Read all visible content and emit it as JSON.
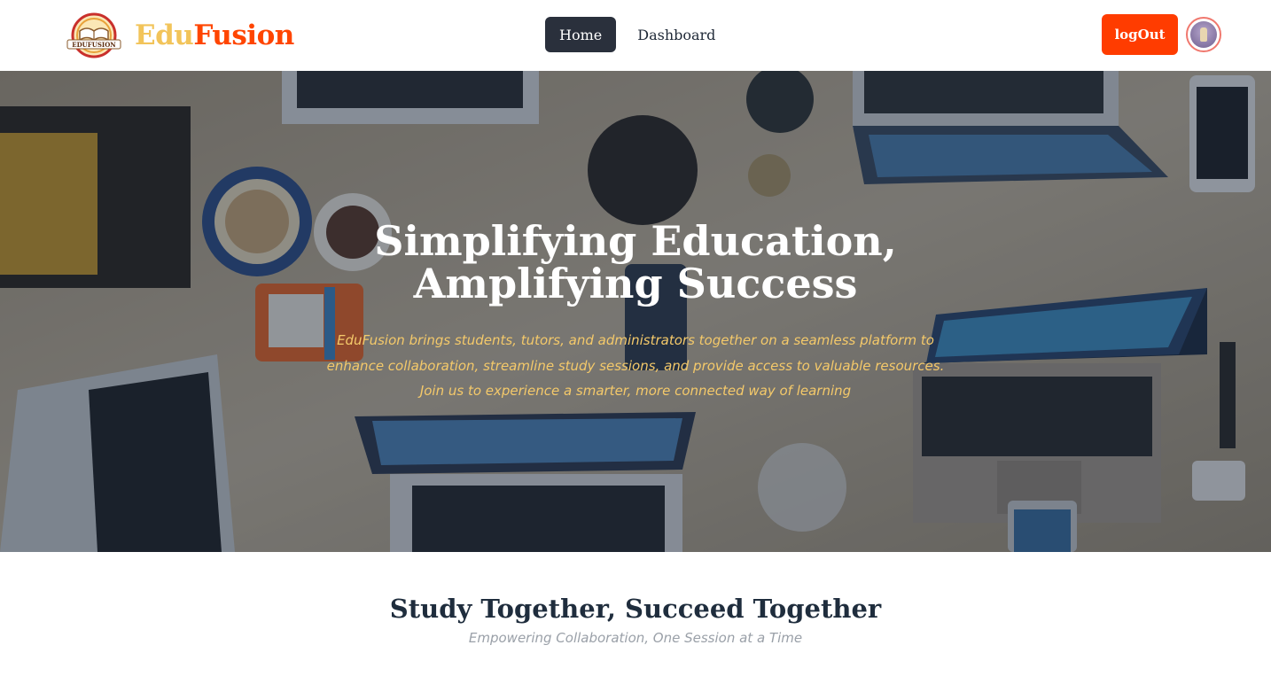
{
  "navbar": {
    "brand": {
      "part1": "Edu",
      "part2": "Fusion",
      "logo_text": "EDUFUSION"
    },
    "links": [
      {
        "label": "Home",
        "active": true
      },
      {
        "label": "Dashboard",
        "active": false
      }
    ],
    "logout_label": "logOut",
    "colors": {
      "brand_edu": "#f2c45a",
      "brand_fusion": "#ff4500",
      "logout": "#ff3c00",
      "active_link": "#2a303c"
    }
  },
  "hero": {
    "title_line1": "Simplifying Education,",
    "title_line2": "Amplifying Success",
    "description": "EduFusion brings students, tutors, and administrators together on a seamless platform to enhance collaboration, streamline study sessions, and provide access to valuable resources. Join us to experience a smarter, more connected way of learning",
    "background": "workspace-photo"
  },
  "section": {
    "title": "Study Together, Succeed Together",
    "subtitle": "Empowering Collaboration, One Session at a Time"
  }
}
